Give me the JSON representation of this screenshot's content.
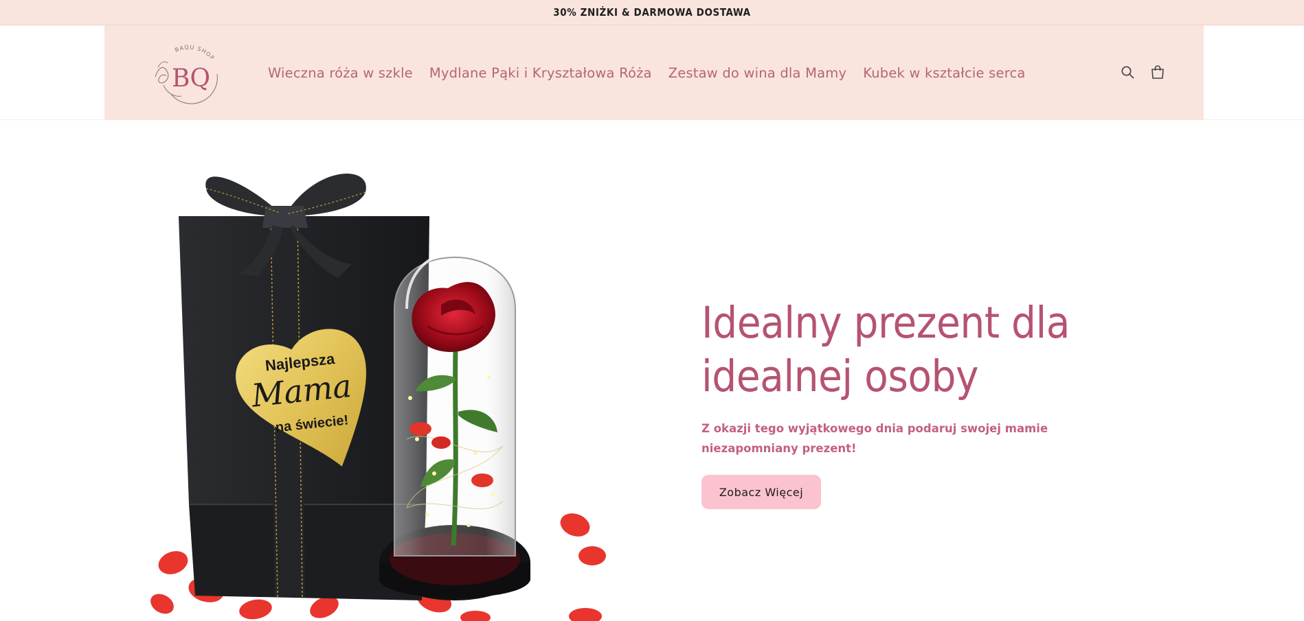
{
  "announcement": {
    "text": "30% ZNIŻKI & DARMOWA DOSTAWA"
  },
  "header": {
    "logo": {
      "monogram": "BQ",
      "arc_text": "BAQU SHOP"
    },
    "nav": [
      {
        "label": "Wieczna róża w szkle"
      },
      {
        "label": "Mydlane Pąki i Kryształowa Róża"
      },
      {
        "label": "Zestaw do wina dla Mamy"
      },
      {
        "label": "Kubek w kształcie serca"
      }
    ],
    "icons": {
      "search": "search-icon",
      "cart": "cart-icon"
    }
  },
  "hero": {
    "title_line1": "Idealny prezent dla",
    "title_line2": "idealnej osoby",
    "subtitle": "Z okazji tego wyjątkowego dnia podaruj swojej mamie niezapomniany prezent!",
    "button_label": "Zobacz Więcej",
    "image": {
      "heart_line1": "Najlepsza",
      "heart_line2": "Mama",
      "heart_line3": "na świecie!"
    }
  },
  "colors": {
    "header_bg": "#f9e5dd",
    "accent": "#b55370",
    "nav_text": "#b5647a",
    "button_bg": "#fbc2cf"
  }
}
